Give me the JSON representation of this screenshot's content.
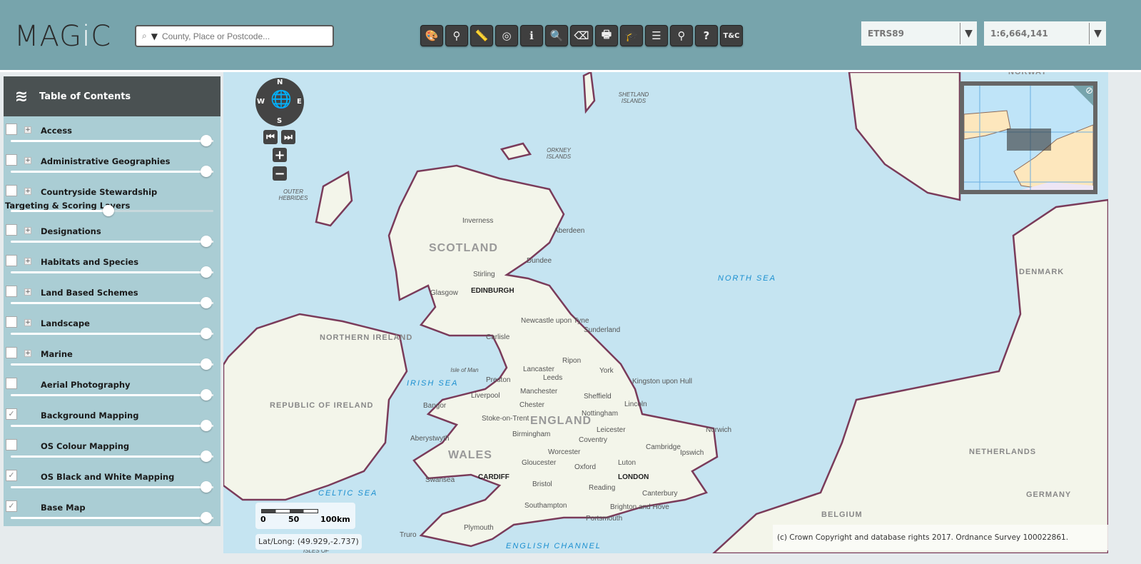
{
  "header": {
    "logo": {
      "part1": "MAG",
      "part2": "i",
      "part3": "C"
    },
    "search": {
      "placeholder": "County, Place or Postcode...",
      "icon": "search-icon",
      "dropdown_icon": "triangle-down-icon"
    },
    "toolbar": [
      {
        "name": "map-style-button",
        "icon": "palette-icon",
        "glyph": "🎨"
      },
      {
        "name": "search-button",
        "icon": "magnifier-icon",
        "glyph": "⚲"
      },
      {
        "name": "measure-button",
        "icon": "ruler-icon",
        "glyph": "📏"
      },
      {
        "name": "locate-button",
        "icon": "crosshair-icon",
        "glyph": "◎"
      },
      {
        "name": "info-button",
        "icon": "info-icon",
        "glyph": "ℹ"
      },
      {
        "name": "query-button",
        "icon": "document-search-icon",
        "glyph": "🔍"
      },
      {
        "name": "erase-button",
        "icon": "eraser-icon",
        "glyph": "⌫"
      },
      {
        "name": "print-button",
        "icon": "printer-icon",
        "glyph": "🖶"
      },
      {
        "name": "learning-button",
        "icon": "mortarboard-icon",
        "glyph": "🎓"
      },
      {
        "name": "legend-button",
        "icon": "list-icon",
        "glyph": "☰"
      },
      {
        "name": "layer-search-button",
        "icon": "layers-search-icon",
        "glyph": "⚲"
      },
      {
        "name": "help-button",
        "icon": "question-icon",
        "glyph": "?"
      },
      {
        "name": "terms-button",
        "icon": "tc-icon",
        "glyph": "T&C"
      }
    ],
    "projection": {
      "value": "ETRS89"
    },
    "scale": {
      "value": "1:6,664,141"
    }
  },
  "toc": {
    "title": "Table of Contents",
    "layers": [
      {
        "label": "Access",
        "checked": false,
        "expandable": true,
        "opacity": 1.0
      },
      {
        "label": "Administrative Geographies",
        "checked": false,
        "expandable": true,
        "opacity": 1.0
      },
      {
        "label": "Countryside Stewardship Targeting & Scoring Layers",
        "checked": false,
        "expandable": true,
        "opacity": 0.5
      },
      {
        "label": "Designations",
        "checked": false,
        "expandable": true,
        "opacity": 1.0
      },
      {
        "label": "Habitats and Species",
        "checked": false,
        "expandable": true,
        "opacity": 1.0
      },
      {
        "label": "Land Based Schemes",
        "checked": false,
        "expandable": true,
        "opacity": 1.0
      },
      {
        "label": "Landscape",
        "checked": false,
        "expandable": true,
        "opacity": 1.0
      },
      {
        "label": "Marine",
        "checked": false,
        "expandable": true,
        "opacity": 1.0
      },
      {
        "label": "Aerial Photography",
        "checked": false,
        "expandable": false,
        "opacity": 1.0
      },
      {
        "label": "Background Mapping",
        "checked": true,
        "expandable": false,
        "opacity": 1.0
      },
      {
        "label": "OS Colour Mapping",
        "checked": false,
        "expandable": false,
        "opacity": 1.0
      },
      {
        "label": "OS Black and White Mapping",
        "checked": true,
        "expandable": false,
        "opacity": 1.0
      },
      {
        "label": "Base Map",
        "checked": true,
        "expandable": false,
        "opacity": 1.0
      }
    ]
  },
  "map": {
    "compass": {
      "n": "N",
      "e": "E",
      "s": "S",
      "w": "W"
    },
    "labels": {
      "shetland": "SHETLAND ISLANDS",
      "orkney": "ORKNEY ISLANDS",
      "outer_hebrides": "OUTER HEBRIDES",
      "norway": "NORWAY",
      "scotland": "SCOTLAND",
      "england": "ENGLAND",
      "wales": "WALES",
      "northern_ireland": "NORTHERN IRELAND",
      "republic_of_ireland": "REPUBLIC OF IRELAND",
      "denmark": "DENMARK",
      "netherlands": "NETHERLANDS",
      "germany": "GERMANY",
      "belgium": "BELGIUM",
      "north_sea": "NORTH SEA",
      "irish_sea": "IRISH SEA",
      "celtic_sea": "CELTIC SEA",
      "english_channel": "ENGLISH CHANNEL",
      "inverness": "Inverness",
      "aberdeen": "Aberdeen",
      "dundee": "Dundee",
      "stirling": "Stirling",
      "glasgow": "Glasgow",
      "edinburgh": "EDINBURGH",
      "newcastle": "Newcastle upon Tyne",
      "sunderland": "Sunderland",
      "carlisle": "Carlisle",
      "isle_of_man": "Isle of Man",
      "ripon": "Ripon",
      "lancaster": "Lancaster",
      "leeds": "Leeds",
      "york": "York",
      "preston": "Preston",
      "hull": "Kingston upon Hull",
      "liverpool": "Liverpool",
      "manchester": "Manchester",
      "sheffield": "Sheffield",
      "bangor": "Bangor",
      "chester": "Chester",
      "lincoln": "Lincoln",
      "stoke": "Stoke-on-Trent",
      "nottingham": "Nottingham",
      "leicester": "Leicester",
      "norwich": "Norwich",
      "aberystwyth": "Aberystwyth",
      "birmingham": "Birmingham",
      "coventry": "Coventry",
      "worcester": "Worcester",
      "cambridge": "Cambridge",
      "ipswich": "Ipswich",
      "gloucester": "Gloucester",
      "oxford": "Oxford",
      "luton": "Luton",
      "cardiff": "CARDIFF",
      "london": "LONDON",
      "swansea": "Swansea",
      "bristol": "Bristol",
      "reading": "Reading",
      "canterbury": "Canterbury",
      "southampton": "Southampton",
      "brighton": "Brighton and Hove",
      "portsmouth": "Portsmouth",
      "plymouth": "Plymouth",
      "truro": "Truro",
      "isles_of_scilly": "ISLES OF"
    },
    "scalebar": {
      "ticks": [
        "0",
        "50",
        "100km"
      ]
    },
    "latlong": "Lat/Long: (49.929,-2.737)",
    "copyright": "(c) Crown Copyright and database rights 2017. Ordnance Survey 100022861.",
    "colors": {
      "sea": "#c5e4f1",
      "land": "#f3f5ea",
      "coast": "#7a3b5a",
      "header": "#77a4ac",
      "toc": "#aacdd4"
    }
  }
}
